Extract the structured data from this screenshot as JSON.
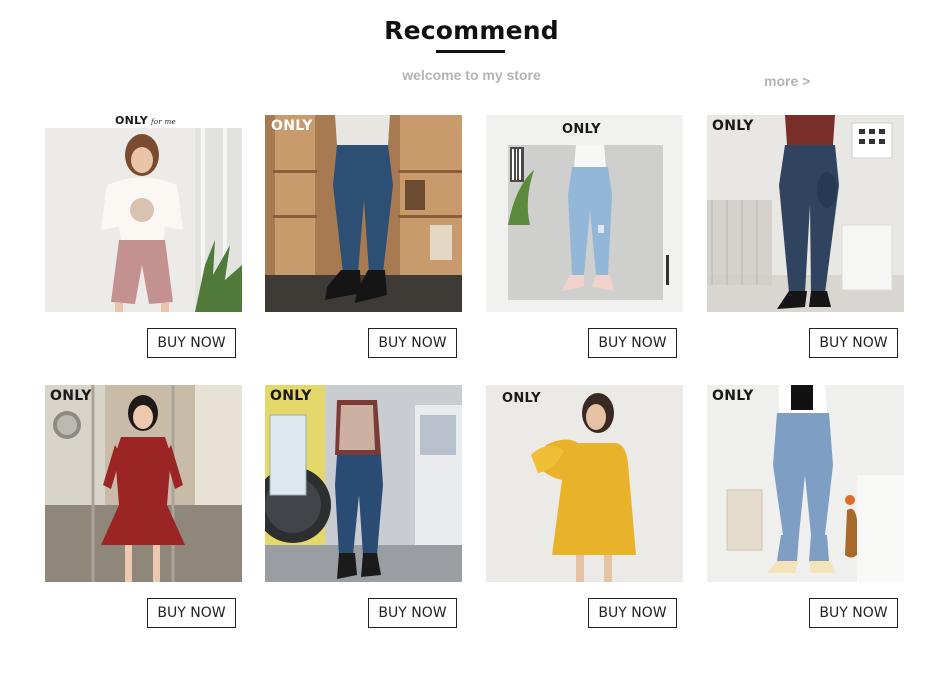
{
  "header": {
    "title": "Recommend",
    "subtitle": "welcome to my store",
    "more_label": "more >"
  },
  "products": [
    {
      "brand": "ONLY",
      "brand_sub": "for me",
      "button_label": "BUY NOW",
      "image_icon": "pink-tee-shorts-photo"
    },
    {
      "brand": "ONLY",
      "button_label": "BUY NOW",
      "image_icon": "dark-jeans-photo"
    },
    {
      "brand": "ONLY",
      "button_label": "BUY NOW",
      "image_icon": "light-ripped-jeans-photo"
    },
    {
      "brand": "ONLY",
      "button_label": "BUY NOW",
      "image_icon": "wrap-waist-jeans-photo"
    },
    {
      "brand": "ONLY",
      "button_label": "BUY NOW",
      "image_icon": "red-dress-photo"
    },
    {
      "brand": "ONLY",
      "button_label": "BUY NOW",
      "image_icon": "knit-vest-jeans-photo"
    },
    {
      "brand": "ONLY",
      "button_label": "BUY NOW",
      "image_icon": "yellow-dress-photo"
    },
    {
      "brand": "ONLY",
      "button_label": "BUY NOW",
      "image_icon": "balloon-jeans-photo"
    }
  ],
  "colors": {
    "title": "#111111",
    "muted": "#b3b3b3",
    "button_border": "#222222"
  }
}
